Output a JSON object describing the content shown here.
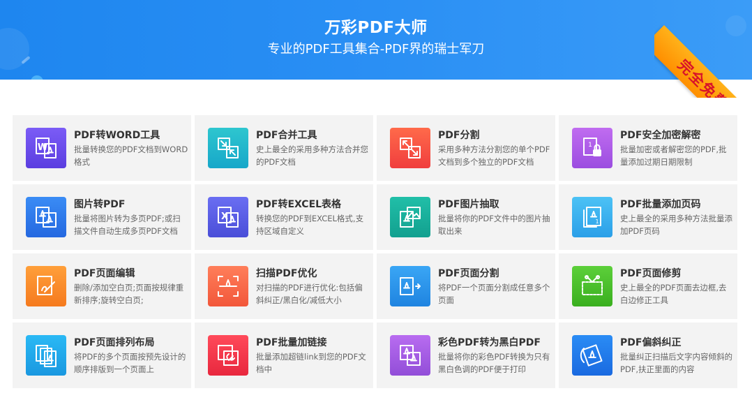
{
  "header": {
    "title": "万彩PDF大师",
    "subtitle": "专业的PDF工具集合-PDF界的瑞士军刀",
    "badge": "完全免费"
  },
  "tools": [
    {
      "title": "PDF转WORD工具",
      "desc": "批量转换您的PDF文档到WORD格式",
      "icon": "word-icon",
      "color_from": "#7b5cf6",
      "color_to": "#5b3ee0"
    },
    {
      "title": "PDF合并工具",
      "desc": "史上最全的采用多种方法合并您的PDF文档",
      "icon": "merge-icon",
      "color_from": "#2ec6cf",
      "color_to": "#17a7c9"
    },
    {
      "title": "PDF分割",
      "desc": "采用多种方法分割您的单个PDF文档到多个独立的PDF文档",
      "icon": "split-icon",
      "color_from": "#ff6a4a",
      "color_to": "#f03e3e"
    },
    {
      "title": "PDF安全加密解密",
      "desc": "批量加密或者解密您的PDF,批量添加过期日期限制",
      "icon": "lock-icon",
      "color_from": "#c06cf0",
      "color_to": "#9b4de0"
    },
    {
      "title": "图片转PDF",
      "desc": "批量将图片转为多页PDF;或扫描文件自动生成多页PDF文档",
      "icon": "image-to-pdf-icon",
      "color_from": "#3a8cf5",
      "color_to": "#2568e0"
    },
    {
      "title": "PDF转EXCEL表格",
      "desc": "转换您的PDF到EXCEL格式,支持区域自定义",
      "icon": "excel-icon",
      "color_from": "#6a6ef2",
      "color_to": "#4a4ed8"
    },
    {
      "title": "PDF图片抽取",
      "desc": "批量将你的PDF文件中的图片抽取出来",
      "icon": "image-extract-icon",
      "color_from": "#21bfa8",
      "color_to": "#12a08f"
    },
    {
      "title": "PDF批量添加页码",
      "desc": "史上最全的采用多种方法批量添加PDF页码",
      "icon": "page-number-icon",
      "color_from": "#4cc2f5",
      "color_to": "#2b9fe8"
    },
    {
      "title": "PDF页面编辑",
      "desc": "删除/添加空白页;页面按规律重新排序;旋转空白页;",
      "icon": "edit-icon",
      "color_from": "#ff9f3a",
      "color_to": "#f57a1e"
    },
    {
      "title": "扫描PDF优化",
      "desc": "对扫描的PDF进行优化:包括偏斜纠正/黑白化/减低大小",
      "icon": "scan-optimize-icon",
      "color_from": "#ff7e5a",
      "color_to": "#f2573a"
    },
    {
      "title": "PDF页面分割",
      "desc": "将PDF一个页面分割成任意多个页面",
      "icon": "page-split-icon",
      "color_from": "#3aa6f5",
      "color_to": "#1f84e0"
    },
    {
      "title": "PDF页面修剪",
      "desc": "史上最全的PDF页面去边框,去白边修正工具",
      "icon": "crop-icon",
      "color_from": "#5ccf3a",
      "color_to": "#3aaf1f"
    },
    {
      "title": "PDF页面排列布局",
      "desc": "将PDF的多个页面按预先设计的顺序排版到一个页面上",
      "icon": "layout-icon",
      "color_from": "#2ab9f5",
      "color_to": "#1a98e0"
    },
    {
      "title": "PDF批量加链接",
      "desc": "批量添加超链link到您的PDF文档中",
      "icon": "link-icon",
      "color_from": "#ff4a5a",
      "color_to": "#e8283e"
    },
    {
      "title": "彩色PDF转为黑白PDF",
      "desc": "批量将你的彩色PDF转换为只有黑白色调的PDF便于打印",
      "icon": "color-to-bw-icon",
      "color_from": "#b86cf0",
      "color_to": "#924ed8"
    },
    {
      "title": "PDF偏斜纠正",
      "desc": "批量纠正扫描后文字内容倾斜的PDF,扶正里面的内容",
      "icon": "deskew-icon",
      "color_from": "#2a8cf5",
      "color_to": "#1a6ae0"
    }
  ]
}
